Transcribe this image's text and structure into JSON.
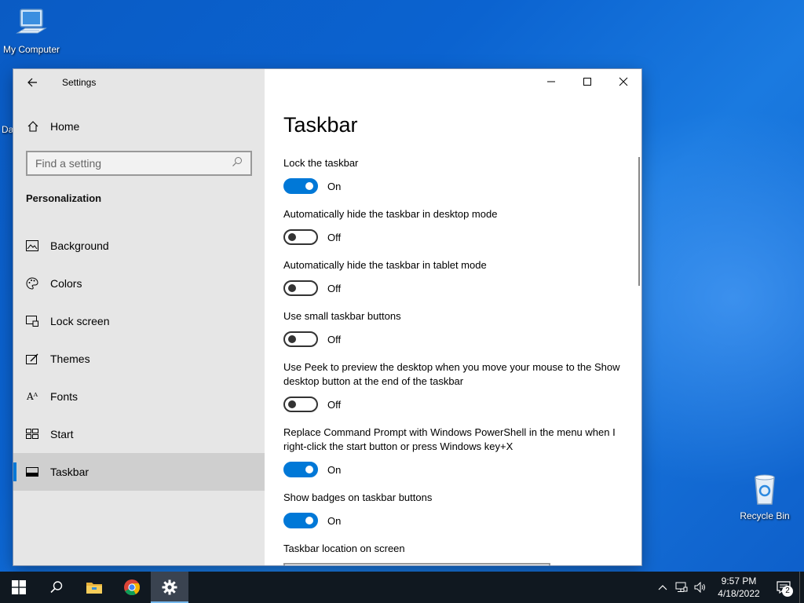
{
  "desktop": {
    "icons": [
      {
        "label": "My Computer"
      },
      {
        "label": "Recycle Bin"
      }
    ],
    "partial_label": "Da"
  },
  "window": {
    "app_title": "Settings",
    "home_label": "Home",
    "search_placeholder": "Find a setting",
    "section_title": "Personalization",
    "nav_items": [
      {
        "label": "Background",
        "icon": "image-icon"
      },
      {
        "label": "Colors",
        "icon": "palette-icon"
      },
      {
        "label": "Lock screen",
        "icon": "lock-screen-icon"
      },
      {
        "label": "Themes",
        "icon": "themes-icon"
      },
      {
        "label": "Fonts",
        "icon": "fonts-icon"
      },
      {
        "label": "Start",
        "icon": "start-icon"
      },
      {
        "label": "Taskbar",
        "icon": "taskbar-icon",
        "active": true
      }
    ],
    "page_title": "Taskbar",
    "settings": [
      {
        "label": "Lock the taskbar",
        "state": "On"
      },
      {
        "label": "Automatically hide the taskbar in desktop mode",
        "state": "Off"
      },
      {
        "label": "Automatically hide the taskbar in tablet mode",
        "state": "Off"
      },
      {
        "label": "Use small taskbar buttons",
        "state": "Off"
      },
      {
        "label": "Use Peek to preview the desktop when you move your mouse to the Show desktop button at the end of the taskbar",
        "state": "Off"
      },
      {
        "label": "Replace Command Prompt with Windows PowerShell in the menu when I right-click the start button or press Windows key+X",
        "state": "On"
      },
      {
        "label": "Show badges on taskbar buttons",
        "state": "On"
      },
      {
        "label": "Taskbar location on screen",
        "state": ""
      }
    ]
  },
  "taskbar": {
    "time": "9:57 PM",
    "date": "4/18/2022",
    "notification_count": "2",
    "apps": [
      "start-icon",
      "search-icon",
      "file-explorer-icon",
      "chrome-icon",
      "settings-gear-icon"
    ]
  },
  "colors": {
    "accent": "#0078d7",
    "sidebar_bg": "#e6e6e6",
    "taskbar_bg": "#101820"
  }
}
